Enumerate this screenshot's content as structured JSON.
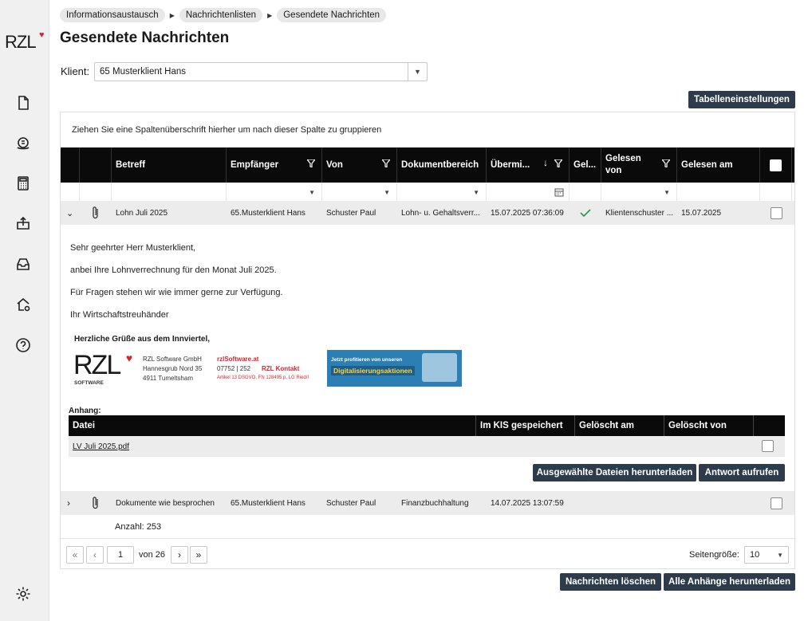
{
  "sidebar": {
    "logo": "RZL",
    "icons": [
      "document-icon",
      "coins-icon",
      "calculator-icon",
      "upload-box-icon",
      "inbox-icon",
      "home-settings-icon",
      "help-icon",
      "settings-icon"
    ]
  },
  "breadcrumb": [
    "Informationsaustausch",
    "Nachrichtenlisten",
    "Gesendete Nachrichten"
  ],
  "page_title": "Gesendete Nachrichten",
  "client": {
    "label": "Klient:",
    "value": "65 Musterklient Hans"
  },
  "buttons": {
    "table_settings": "Tabelleneinstellungen",
    "download_selected": "Ausgewählte Dateien herunterladen",
    "reply": "Antwort aufrufen",
    "delete_messages": "Nachrichten löschen",
    "download_all": "Alle Anhänge herunterladen"
  },
  "grid": {
    "group_hint": "Ziehen Sie eine Spaltenüberschrift hierher um nach dieser Spalte zu gruppieren",
    "columns": {
      "betreff": "Betreff",
      "empfaenger": "Empfänger",
      "von": "Von",
      "bereich": "Dokumentbereich",
      "uebermittelt": "Übermi...",
      "gelesen": "Gel...",
      "gelesen_von": "Gelesen von",
      "gelesen_am": "Gelesen am"
    },
    "rows": [
      {
        "betreff": "Lohn Juli 2025",
        "empfaenger": "65.Musterklient Hans",
        "von": "Schuster Paul",
        "bereich": "Lohn- u. Gehaltsverr...",
        "uebermittelt": "15.07.2025 07:36:09",
        "gelesen_von": "Klientenschuster ...",
        "gelesen_am": "15.07.2025"
      },
      {
        "betreff": "Dokumente wie besprochen",
        "empfaenger": "65.Musterklient Hans",
        "von": "Schuster Paul",
        "bereich": "Finanzbuchhaltung",
        "uebermittelt": "14.07.2025 13:07:59",
        "gelesen_von": "",
        "gelesen_am": ""
      }
    ],
    "count": "Anzahl: 253"
  },
  "message": {
    "greeting": "Sehr geehrter Herr Musterklient,",
    "line1": "anbei Ihre Lohnverrechnung für den Monat Juli 2025.",
    "line2": "Für Fragen stehen wir wie immer gerne zur Verfügung.",
    "closing": "Ihr Wirtschaftstreuhänder",
    "signature_greet": "Herzliche Grüße aus dem Innviertel,",
    "sig_logo": "RZL",
    "sig_logo_sub": "SOFTWARE",
    "sig_company": "RZL Software GmbH",
    "sig_street": "Hannesgrub Nord 35",
    "sig_city": "4911 Tumeltsham",
    "sig_web": "rzlSoftware.at",
    "sig_phone": "07752 | 252",
    "sig_contact": "RZL Kontakt",
    "sig_legal": "Artikel 13 DSGVO, FN 128495 p, LG Ried/I",
    "banner_line1": "Jetzt profitieren von unseren",
    "banner_line2": "Digitalisierungsaktionen"
  },
  "attachments": {
    "label": "Anhang:",
    "columns": {
      "datei": "Datei",
      "kis": "Im KIS gespeichert",
      "geloescht_am": "Gelöscht am",
      "geloescht_von": "Gelöscht von"
    },
    "files": [
      {
        "name": "LV Juli 2025.pdf"
      }
    ]
  },
  "pager": {
    "page": "1",
    "of": "von 26",
    "size_label": "Seitengröße:",
    "size": "10"
  },
  "colors": {
    "accent_dark": "#2d3b4a",
    "header_bg": "#0a0a0a",
    "brand_red": "#d9232e",
    "check_green": "#2f8f5b"
  }
}
